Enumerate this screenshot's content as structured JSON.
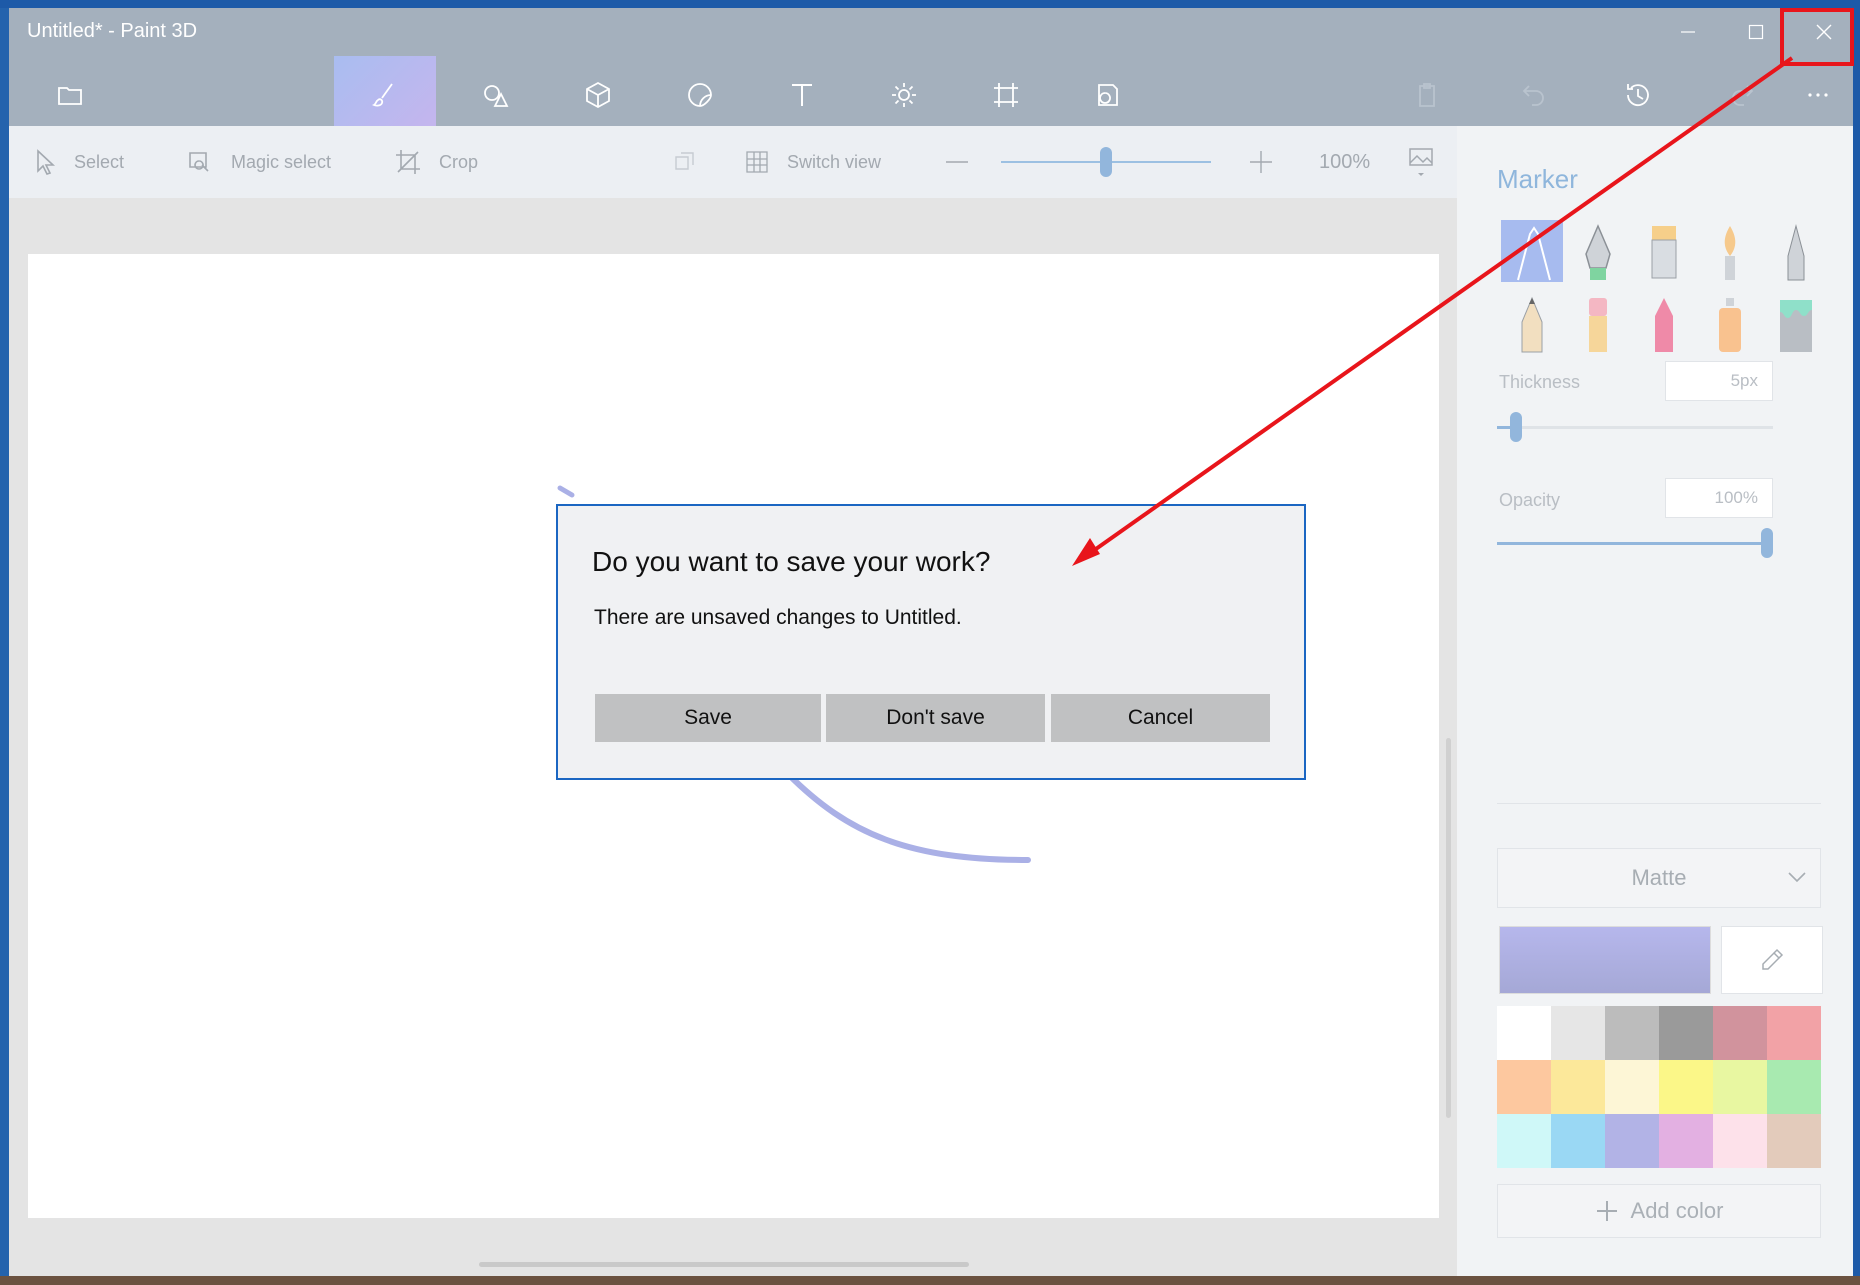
{
  "window": {
    "title": "Untitled* - Paint 3D",
    "controls": [
      "minimize-icon",
      "maximize-icon",
      "close-icon"
    ]
  },
  "ribbon": {
    "tabs": [
      "menu-icon",
      "brushes-icon",
      "2d-shapes-icon",
      "3d-shapes-icon",
      "stickers-icon",
      "text-icon",
      "effects-icon",
      "canvas-icon",
      "3d-library-icon"
    ],
    "active_tab": "brushes-icon",
    "right_icons": [
      "paste-icon",
      "undo-icon",
      "history-icon",
      "redo-icon",
      "more-icon"
    ]
  },
  "toolbar": {
    "select_label": "Select",
    "magic_select_label": "Magic select",
    "crop_label": "Crop",
    "switch_view_label": "Switch view",
    "zoom_text": "100%",
    "zoom_slider_fraction": 0.5
  },
  "panel": {
    "title": "Marker",
    "thickness_label": "Thickness",
    "thickness_value": "5px",
    "thickness_fraction": 0.05,
    "opacity_label": "Opacity",
    "opacity_value": "100%",
    "opacity_fraction": 1.0,
    "finish_select": "Matte",
    "add_color_label": "Add color",
    "current_color": "#b3b5ea",
    "palette": [
      "#ffffff",
      "#e6e6e6",
      "#bcbcbc",
      "#9a9a9a",
      "#d1939d",
      "#f2a2a6",
      "#fdc89f",
      "#fce89a",
      "#fdf6d6",
      "#fbf788",
      "#e8f7a1",
      "#a8eab0",
      "#cff8f8",
      "#9ad8f4",
      "#b2b3e6",
      "#e3b0e2",
      "#fde1ea",
      "#e3cbbb"
    ]
  },
  "dialog": {
    "title": "Do you want to save your work?",
    "message": "There are unsaved changes to Untitled.",
    "save_label": "Save",
    "dont_save_label": "Don't save",
    "cancel_label": "Cancel"
  }
}
